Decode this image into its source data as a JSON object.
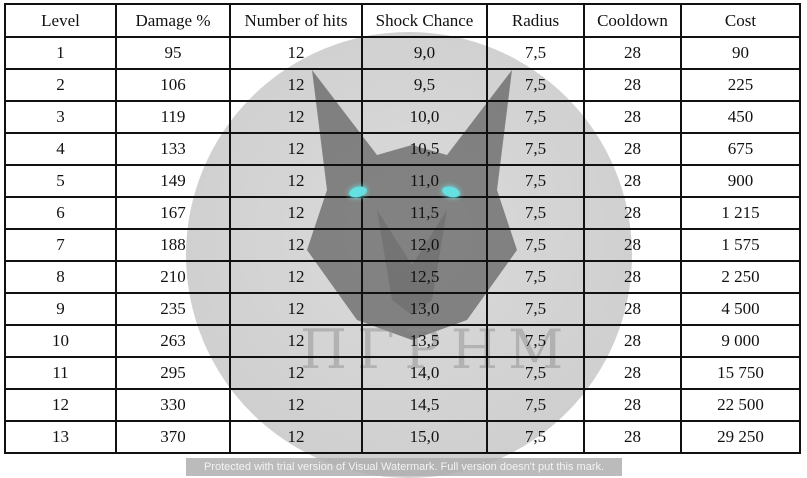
{
  "table": {
    "headers": [
      "Level",
      "Damage %",
      "Number of hits",
      "Shock Chance",
      "Radius",
      "Cooldown",
      "Cost"
    ],
    "rows": [
      [
        "1",
        "95",
        "12",
        "9,0",
        "7,5",
        "28",
        "90"
      ],
      [
        "2",
        "106",
        "12",
        "9,5",
        "7,5",
        "28",
        "225"
      ],
      [
        "3",
        "119",
        "12",
        "10,0",
        "7,5",
        "28",
        "450"
      ],
      [
        "4",
        "133",
        "12",
        "10,5",
        "7,5",
        "28",
        "675"
      ],
      [
        "5",
        "149",
        "12",
        "11,0",
        "7,5",
        "28",
        "900"
      ],
      [
        "6",
        "167",
        "12",
        "11,5",
        "7,5",
        "28",
        "1 215"
      ],
      [
        "7",
        "188",
        "12",
        "12,0",
        "7,5",
        "28",
        "1 575"
      ],
      [
        "8",
        "210",
        "12",
        "12,5",
        "7,5",
        "28",
        "2 250"
      ],
      [
        "9",
        "235",
        "12",
        "13,0",
        "7,5",
        "28",
        "4 500"
      ],
      [
        "10",
        "263",
        "12",
        "13,5",
        "7,5",
        "28",
        "9 000"
      ],
      [
        "11",
        "295",
        "12",
        "14,0",
        "7,5",
        "28",
        "15 750"
      ],
      [
        "12",
        "330",
        "12",
        "14,5",
        "7,5",
        "28",
        "22 500"
      ],
      [
        "13",
        "370",
        "12",
        "15,0",
        "7,5",
        "28",
        "29 250"
      ]
    ]
  },
  "watermark": {
    "rune_text": "ΠΓΡΗΜ",
    "trial_text": "Protected with trial version of Visual Watermark. Full version doesn't put this mark.",
    "eye_color": "#64e0e2"
  }
}
